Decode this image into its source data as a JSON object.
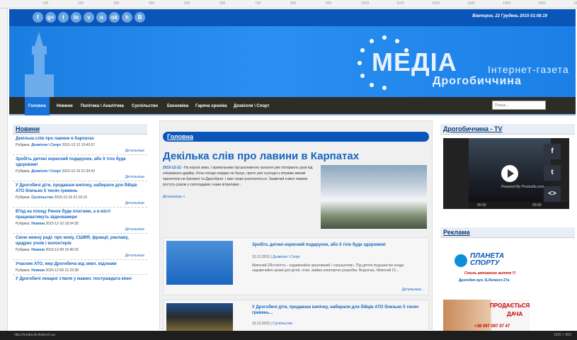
{
  "ruler": {
    "ticks": [
      "100",
      "200",
      "300",
      "400",
      "500",
      "600",
      "700",
      "800",
      "900",
      "1000",
      "1100",
      "1200",
      "1300",
      "1400",
      "1500",
      "1600"
    ]
  },
  "topbar": {
    "socials": [
      "f",
      "g+",
      "t",
      "in",
      "v",
      "o",
      "ok",
      "h",
      "B"
    ],
    "datetime": "Вівторок, 22 Грудень 2015 01:08:19"
  },
  "banner": {
    "logo_main": "МЕДІА",
    "logo_sub": "Інтернет-газета",
    "logo_city": "Дрогобиччина"
  },
  "nav": {
    "items": [
      "Головна",
      "Новини",
      "Політика \\ Аналітика",
      "Суспільство",
      "Економіка",
      "Гаряча хроніка",
      "Дозвілля \\ Спорт"
    ],
    "search_placeholder": "Пошук..."
  },
  "news": {
    "heading": "Новини",
    "more": "Детальніше",
    "items": [
      {
        "title": "Декілька слів про лавини в Карпатах",
        "rubric": "Дозвілля \\ Спорт",
        "date": "2015-12-12 10:43:57"
      },
      {
        "title": "Зробіть дитині корисний подарунок, або її тіло буде здоровим!",
        "rubric": "Дозвілля \\ Спорт",
        "date": "2015-12-10 21:34:52"
      },
      {
        "title": "У Дрогобичі діти, продавши випічку, набирали для бійців АТО близько 5 тисяч гривень",
        "rubric": "Суспільство",
        "date": "2015-12-10 21:10:16"
      },
      {
        "title": "В'їзд на площу Ринок буде платним, а в місті працюватимуть відеокамери",
        "rubric": "Новини",
        "date": "2015-12-10 18:34:35"
      },
      {
        "title": "Свою мовну раді: про мову, СШМЯ, фракції, рекламу, щедрих учнів і волонтерів",
        "rubric": "Новини",
        "date": "2015-12-09 22:45:03"
      },
      {
        "title": "Учасник АТО, мер Дрогобича від земл. відзнаки",
        "rubric": "Новини",
        "date": "2015-12-09 21:23:38"
      },
      {
        "title": "У Дрогобичі лекарні з'явля у мажин: постраждата кінні-"
      }
    ],
    "rubric_label": "Рубрика:"
  },
  "main": {
    "heading": "Головна",
    "lead": {
      "title": "Декілька слів про лавини в Карпатах",
      "date": "2015-12-12 -",
      "text": "На порозі зима. І прихильники гірськолижного катання уже потирають руки від очікуваного драйву. Хоча погода нерідко не балує, проте уже сьогодні з вітрами зимові прилетили на буковелі та Драгобраті. І вже скоро розпочнеться. Зазвичай сніжні лавини ростуть разом з снігопадами і нами вітрилами...",
      "more": "Детальніше »"
    },
    "cards": [
      {
        "title": "Зробіть дитині корисний подарунок, або її тіло буде здоровим!",
        "date": "10.12.2015",
        "rubric": "Дозвілля \\ Спорт",
        "text": "Миколай 2Ястолітта – надзвичайно креативний і «грошунтив». Під дитячі подушки він кладе надзвичайно цікаві для дітей, отже, майже електричні розробки. Водночас, Миколай 21...",
        "more": "Детальніше..."
      },
      {
        "title": "У Дрогобичі діти, продавши випічку, набирали для бійців АТО близько 5 тисяч гривень...",
        "date": "10.12.2015",
        "rubric": "Суспільство"
      }
    ]
  },
  "right": {
    "tv_heading": "Дрогобиччина - TV",
    "tv_brand": "Powered By Prostudio.com",
    "tv_time": "00:00",
    "ads_heading": "Реклама",
    "ad1_brand": "ПЛАНЕТА СПОРТУ",
    "ad1_tagline": "Стиль активного життя !!!",
    "ad1_address": "Дрогобич вул. Б.Лепкого 27а",
    "ad2_title": "ПРОДАЄТЬСЯ",
    "ad2_sub": "ДАЧА",
    "ad2_phone": "+38 097 097 07 47"
  },
  "status": {
    "text": "http://media.drohobych.ua",
    "right": "1500 × 800"
  }
}
